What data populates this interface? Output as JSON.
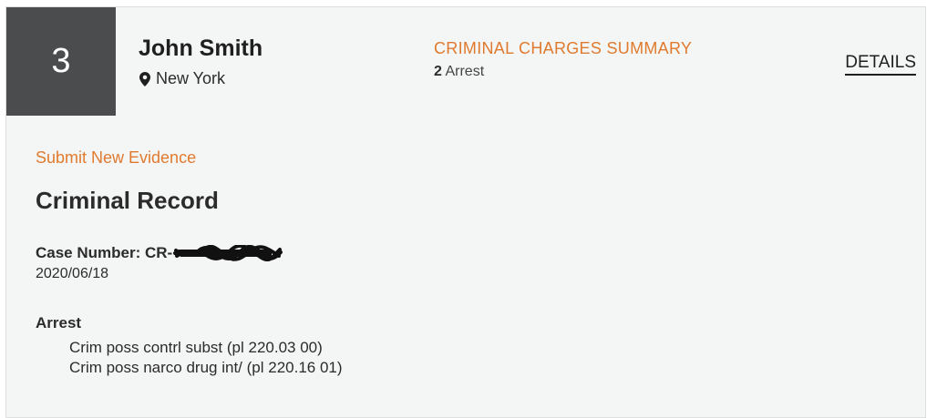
{
  "record": {
    "rank": "3",
    "name": "John Smith",
    "location": "New York",
    "location_icon": "map-pin-icon",
    "charges_summary_title": "CRIMINAL CHARGES SUMMARY",
    "arrest_count": "2",
    "arrest_label": "Arrest",
    "details_label": "DETAILS"
  },
  "evidence": {
    "link_label": "Submit New Evidence"
  },
  "criminal_record": {
    "title": "Criminal Record",
    "case_number_label": "Case Number: CR-",
    "date": "2020/06/18",
    "charge_type": "Arrest",
    "charges": [
      "Crim poss contrl subst (pl 220.03 00)",
      "Crim poss narco drug int/ (pl 220.16 01)"
    ]
  },
  "colors": {
    "accent": "#e07a2f",
    "rank_bg": "#4a4c4e",
    "card_bg": "#f4f6f5"
  }
}
